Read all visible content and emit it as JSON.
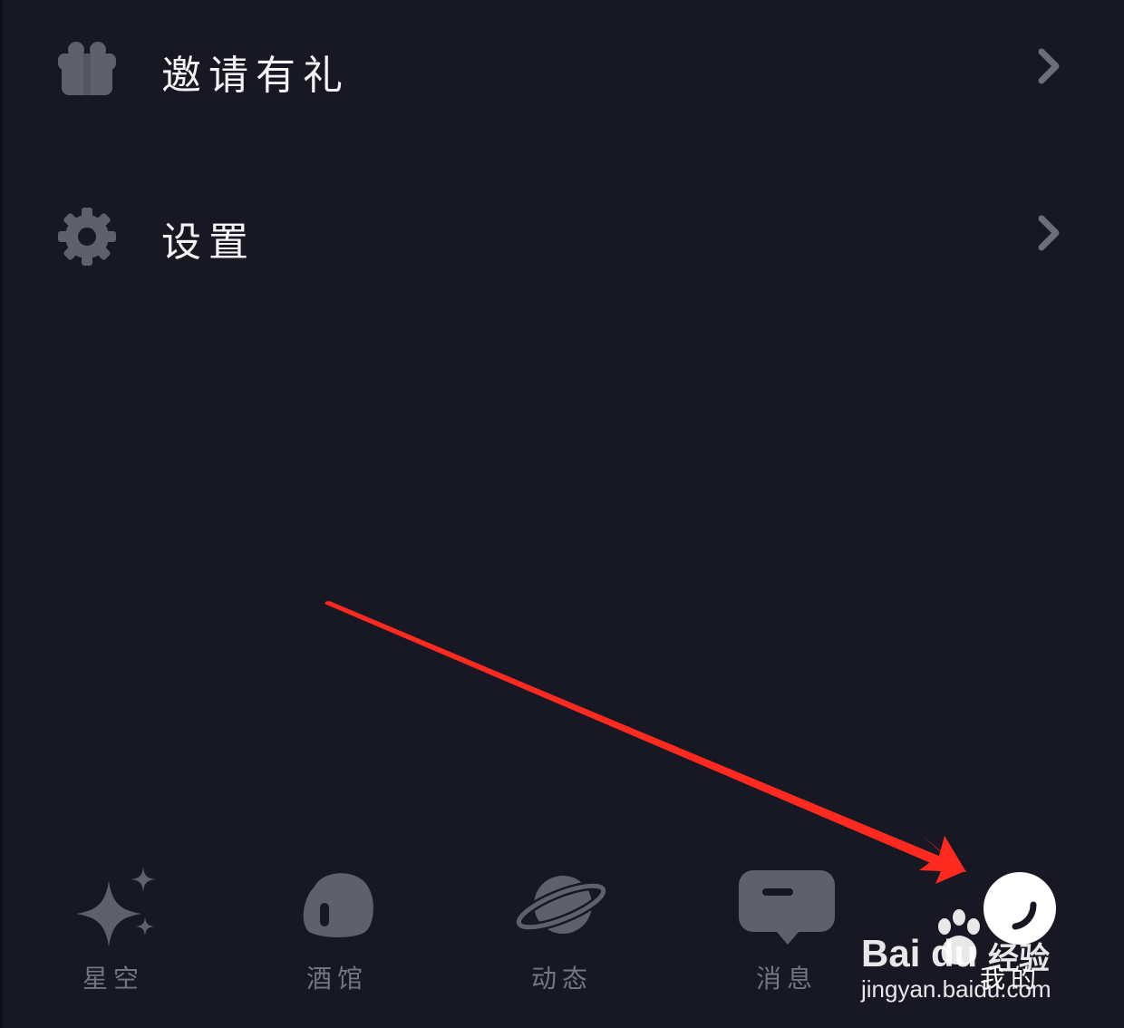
{
  "menu": {
    "items": [
      {
        "label": "邀请有礼",
        "icon": "gift-icon"
      },
      {
        "label": "设置",
        "icon": "gear-icon"
      }
    ]
  },
  "tabbar": {
    "tabs": [
      {
        "label": "星空",
        "icon": "sparkle-icon",
        "active": false
      },
      {
        "label": "酒馆",
        "icon": "tavern-icon",
        "active": false
      },
      {
        "label": "动态",
        "icon": "planet-icon",
        "active": false
      },
      {
        "label": "消息",
        "icon": "message-icon",
        "active": false
      },
      {
        "label": "我的",
        "icon": "profile-icon",
        "active": true
      }
    ]
  },
  "watermark": {
    "brand": "Bai du",
    "brand_cn": "经验",
    "url": "jingyan.baidu.com"
  },
  "colors": {
    "background": "#171824",
    "icon_gray": "#5f606b",
    "text_white": "#ffffff",
    "text_gray": "#74757f",
    "annotation_red": "#ff2a1f"
  }
}
